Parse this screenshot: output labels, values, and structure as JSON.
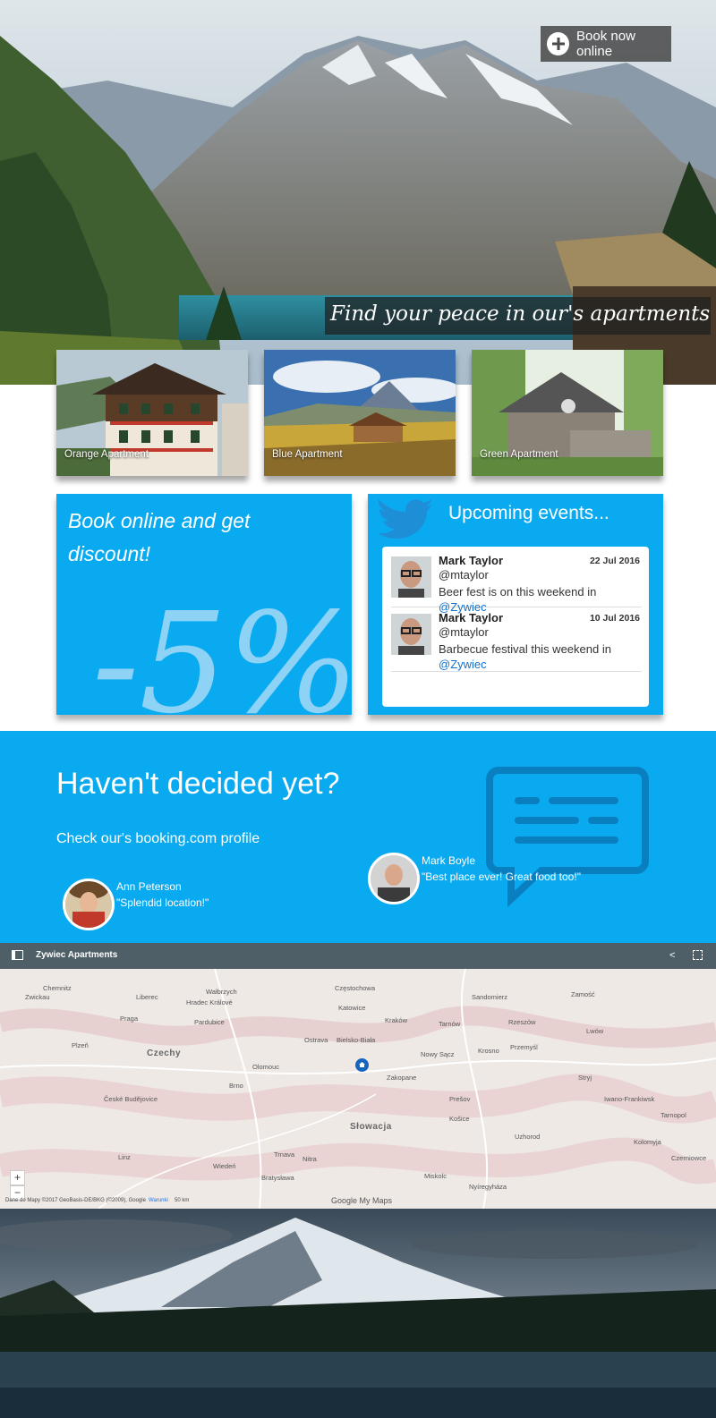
{
  "hero": {
    "book_label": "Book now online",
    "tagline": "Find your peace in our's apartments"
  },
  "apartments": [
    {
      "label": "Orange Apartment"
    },
    {
      "label": "Blue Apartment"
    },
    {
      "label": "Green Apartment"
    }
  ],
  "discount": {
    "text": "Book online and get discount!",
    "value": "-5%"
  },
  "events": {
    "title": "Upcoming events...",
    "tweets": [
      {
        "name": "Mark Taylor",
        "handle": "@mtaylor",
        "date": "22 Jul 2016",
        "text": "Beer fest is on this weekend in ",
        "mention": "@Zywiec"
      },
      {
        "name": "Mark Taylor",
        "handle": "@mtaylor",
        "date": "10 Jul 2016",
        "text": "Barbecue festival this weekend in ",
        "mention": "@Zywiec"
      }
    ]
  },
  "decide": {
    "heading": "Haven't decided yet?",
    "subtitle": "Check our's booking.com profile",
    "reviews": [
      {
        "name": "Ann Peterson",
        "quote": "\"Splendid location!\""
      },
      {
        "name": "Mark Boyle",
        "quote": "\"Best place ever! Great food too!\""
      }
    ]
  },
  "map": {
    "title": "Zywiec Apartments",
    "zoom_in": "+",
    "zoom_out": "−",
    "attribution": "Dane do Mapy ©2017 GeoBasis-DE/BKG (©2009), Google",
    "terms": "Warunki",
    "scale": "50 km",
    "branding": "Google My Maps",
    "countries": [
      "Czechy",
      "Słowacja"
    ],
    "cities": [
      "Chemnitz",
      "Zwickau",
      "Liberec",
      "Wałbrzych",
      "Częstochowa",
      "Sandomierz",
      "Zamość",
      "Lwów",
      "Hradec Králové",
      "Pardubice",
      "Katowice",
      "Kraków",
      "Tarnów",
      "Rzeszów",
      "Praga",
      "Plzeň",
      "Ostrava",
      "Bielsko-Biała",
      "Nowy Sącz",
      "Krosno",
      "Przemyśl",
      "Olomouc",
      "Brno",
      "Zakopane",
      "Prešov",
      "Košice",
      "Uzhorod",
      "Stryj",
      "Iwano-Frankiwsk",
      "České Budějovice",
      "Trnava",
      "Nitra",
      "Bratysława",
      "Linz",
      "Wiedeń",
      "Miskolc",
      "Nyíregyháza",
      "Tarnopol",
      "Kolomyja",
      "Czerniowce"
    ]
  }
}
